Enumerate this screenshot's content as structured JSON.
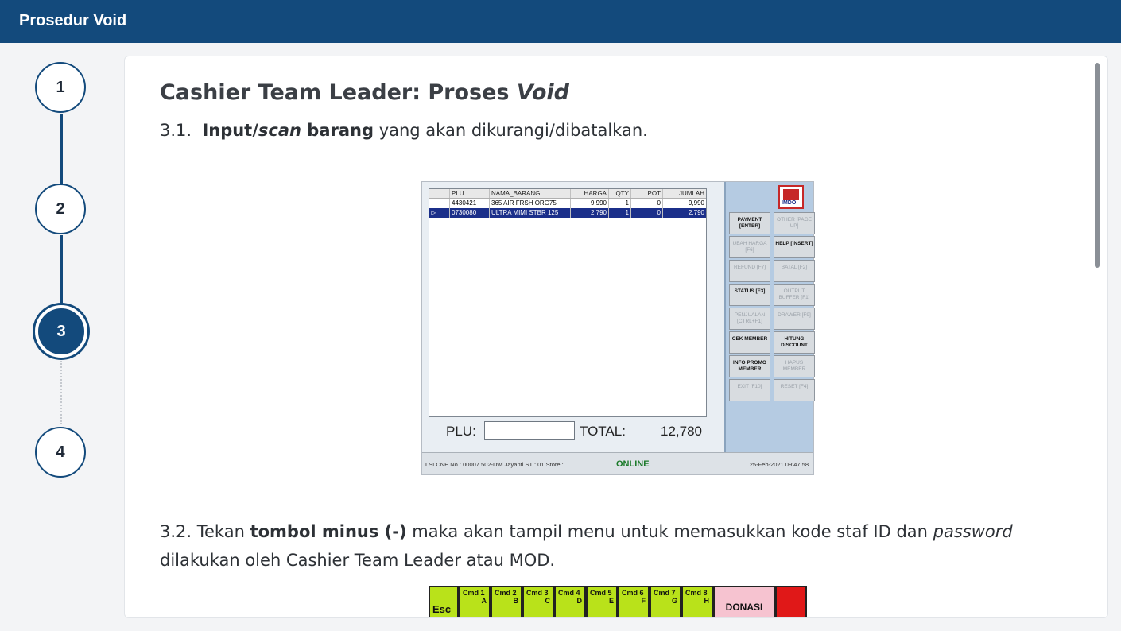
{
  "header": {
    "title": "Prosedur Void"
  },
  "stepper": {
    "steps": [
      {
        "label": "1"
      },
      {
        "label": "2"
      },
      {
        "label": "3"
      },
      {
        "label": "4"
      }
    ],
    "active_step": "3"
  },
  "content": {
    "heading_prefix": "Cashier Team Leader: Proses ",
    "heading_italic": "Void",
    "step1": {
      "number": "3.1.",
      "bold1": "Input/",
      "italic": "scan",
      "bold2": " barang",
      "rest": " yang akan dikurangi/dibatalkan."
    },
    "step2": {
      "number": "3.2.",
      "pre": " Tekan ",
      "bold": "tombol minus (-)",
      "mid": " maka akan tampil menu untuk memasukkan kode staf ID dan ",
      "italic": "password",
      "line2": "dilakukan oleh Cashier Team Leader atau MOD."
    }
  },
  "pos_screen": {
    "columns": [
      "",
      "PLU",
      "NAMA_BARANG",
      "HARGA",
      "QTY",
      "POT",
      "JUMLAH"
    ],
    "rows": [
      {
        "mark": "",
        "plu": "4430421",
        "nama": "365 AIR FRSH ORG75",
        "harga": "9,990",
        "qty": "1",
        "pot": "0",
        "jumlah": "9,990"
      },
      {
        "mark": "▷",
        "plu": "0730080",
        "nama": "ULTRA MIMI STBR 125",
        "harga": "2,790",
        "qty": "1",
        "pot": "0",
        "jumlah": "2,790"
      }
    ],
    "plu_label": "PLU:",
    "total_label": "TOTAL:",
    "total_value": "12,780",
    "logo_text": "IMDO",
    "buttons": [
      {
        "label": "PAYMENT [ENTER]",
        "enabled": true
      },
      {
        "label": "OTHER [PAGE UP]",
        "enabled": false
      },
      {
        "label": "UBAH HARGA [F6]",
        "enabled": false
      },
      {
        "label": "HELP [INSERT]",
        "enabled": true
      },
      {
        "label": "REFUND [F7]",
        "enabled": false
      },
      {
        "label": "BATAL [F2]",
        "enabled": false
      },
      {
        "label": "STATUS [F3]",
        "enabled": true
      },
      {
        "label": "OUTPUT BUFFER [F1]",
        "enabled": false
      },
      {
        "label": "PENJUALAN [CTRL+F1]",
        "enabled": false
      },
      {
        "label": "DRAWER [F9]",
        "enabled": false
      },
      {
        "label": "CEK MEMBER",
        "enabled": true
      },
      {
        "label": "HITUNG DISCOUNT",
        "enabled": true
      },
      {
        "label": "INFO PROMO MEMBER",
        "enabled": true
      },
      {
        "label": "HAPUS MEMBER",
        "enabled": false
      },
      {
        "label": "EXIT [F10]",
        "enabled": false
      },
      {
        "label": "RESET [F4]",
        "enabled": false
      }
    ],
    "status_left": "LSI CNE  No : 00007  502-Dwi.Jayanti  ST : 01  Store :",
    "status_online": "ONLINE",
    "status_right": "25-Feb-2021 09:47:58"
  },
  "keypad": {
    "esc": "Esc",
    "cmds": [
      {
        "label": "Cmd 1",
        "sub": "A"
      },
      {
        "label": "Cmd 2",
        "sub": "B"
      },
      {
        "label": "Cmd 3",
        "sub": "C"
      },
      {
        "label": "Cmd 4",
        "sub": "D"
      },
      {
        "label": "Cmd 5",
        "sub": "E"
      },
      {
        "label": "Cmd 6",
        "sub": "F"
      },
      {
        "label": "Cmd 7",
        "sub": "G"
      },
      {
        "label": "Cmd 8",
        "sub": "H"
      }
    ],
    "donasi": "DONASI"
  },
  "colors": {
    "header_bg": "#134a7c",
    "step_active": "#134a7c",
    "online": "#1b7a2a",
    "keypad_green": "#b9e21a",
    "keypad_pink": "#f6c3d0"
  }
}
